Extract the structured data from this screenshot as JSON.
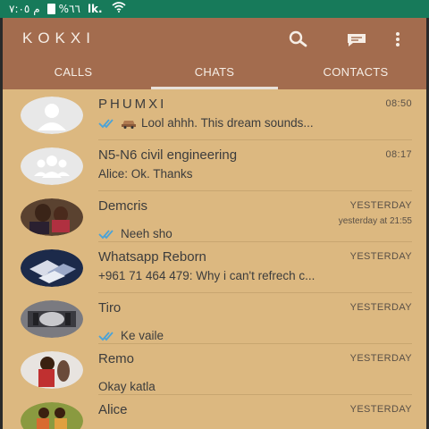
{
  "status_bar": {
    "time": "م ٧:٠٥",
    "battery": "%٦٦",
    "signal": "lk.",
    "wifi_icon": "wifi-icon",
    "color": "#177a5a"
  },
  "app_bar": {
    "title": "KOKXI",
    "color": "#a36c4e",
    "icons": [
      "search-icon",
      "compose-icon",
      "more-vertical-icon"
    ]
  },
  "tabs": [
    {
      "label": "CALLS",
      "active": false
    },
    {
      "label": "CHATS",
      "active": true
    },
    {
      "label": "CONTACTS",
      "active": false
    }
  ],
  "chats": [
    {
      "name": "PHUMXI",
      "time": "08:50",
      "preview": "Lool ahhh. This dream sounds...",
      "sent": true
    },
    {
      "name": "N5-N6 civil engineering",
      "time": "08:17",
      "preview": "Alice: Ok. Thanks",
      "sent": false
    },
    {
      "name": "Demcris",
      "time": "YESTERDAY",
      "subtime": "yesterday at 21:55",
      "preview": "Neeh sho",
      "sent": true
    },
    {
      "name": "Whatsapp Reborn",
      "time": "YESTERDAY",
      "preview": "+961 71 464 479: Why i can't refrech c...",
      "sent": false
    },
    {
      "name": "Tiro",
      "time": "YESTERDAY",
      "preview": "Ke vaile",
      "sent": true
    },
    {
      "name": "Remo",
      "time": "YESTERDAY",
      "preview": "Okay katla",
      "sent": false
    },
    {
      "name": "Alice",
      "time": "YESTERDAY",
      "preview": "",
      "sent": false
    }
  ],
  "colors": {
    "background": "#dcb880",
    "divider": "#c8a670",
    "tick": "#4aa3d8"
  }
}
